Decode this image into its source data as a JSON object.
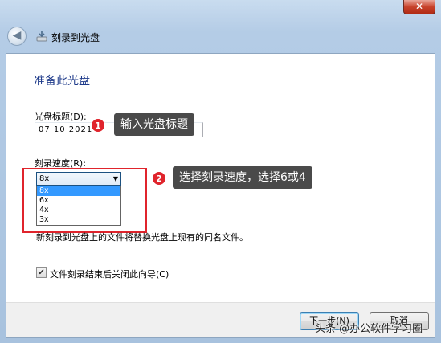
{
  "window": {
    "title": "刻录到光盘",
    "close_glyph": "✕",
    "back_glyph": "◀",
    "icon": "disc-burn-icon"
  },
  "page": {
    "heading": "准备此光盘",
    "disc_title_label": "光盘标题(D):",
    "disc_title_value": "07 10 2021",
    "speed_label": "刻录速度(R):",
    "speed_selected": "8x",
    "speed_options": [
      "8x",
      "6x",
      "4x",
      "3x"
    ],
    "note": "新刻录到光盘上的文件将替换光盘上现有的同名文件。",
    "close_wizard_label": "文件刻录结束后关闭此向导(C)",
    "close_wizard_checked": true
  },
  "buttons": {
    "next": "下一步(N)",
    "cancel": "取消"
  },
  "annotations": {
    "callout1_number": "1",
    "callout1_text": "输入光盘标题",
    "callout2_number": "2",
    "callout2_text": "选择刻录速度，选择6或4",
    "highlight_color": "#e0242c"
  },
  "watermark": "头条 @办公软件学习圈"
}
